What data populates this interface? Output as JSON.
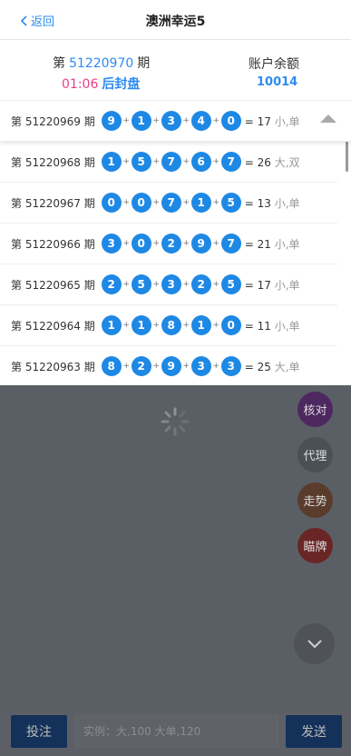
{
  "header": {
    "back_label": "返回",
    "title": "澳洲幸运5"
  },
  "current": {
    "prefix": "第",
    "period": "51220970",
    "suffix": "期",
    "countdown": "01:06",
    "status": "后封盘",
    "balance_label": "账户余额",
    "balance_value": "10014"
  },
  "results": [
    {
      "label": "第 51220969 期",
      "balls": [
        "9",
        "1",
        "3",
        "4",
        "0"
      ],
      "sum": "= 17",
      "tag": "小,单"
    },
    {
      "label": "第 51220968 期",
      "balls": [
        "1",
        "5",
        "7",
        "6",
        "7"
      ],
      "sum": "= 26",
      "tag": "大,双"
    },
    {
      "label": "第 51220967 期",
      "balls": [
        "0",
        "0",
        "7",
        "1",
        "5"
      ],
      "sum": "= 13",
      "tag": "小,单"
    },
    {
      "label": "第 51220966 期",
      "balls": [
        "3",
        "0",
        "2",
        "9",
        "7"
      ],
      "sum": "= 21",
      "tag": "小,单"
    },
    {
      "label": "第 51220965 期",
      "balls": [
        "2",
        "5",
        "3",
        "2",
        "5"
      ],
      "sum": "= 17",
      "tag": "小,单"
    },
    {
      "label": "第 51220964 期",
      "balls": [
        "1",
        "1",
        "8",
        "1",
        "0"
      ],
      "sum": "= 11",
      "tag": "小,单"
    },
    {
      "label": "第 51220963 期",
      "balls": [
        "8",
        "2",
        "9",
        "3",
        "3"
      ],
      "sum": "= 25",
      "tag": "大,单"
    }
  ],
  "plus_sign": "+",
  "side_buttons": {
    "verify": "核对",
    "agent": "代理",
    "trend": "走势",
    "peek": "瞄牌"
  },
  "footer": {
    "bet_label": "投注",
    "input_placeholder": "实例：大,100 大单,120",
    "send_label": "发送"
  },
  "colors": {
    "accent": "#2d8cf0",
    "ball": "#1e88e5",
    "countdown": "#e83e8c",
    "overlay": "#5a5f65"
  }
}
